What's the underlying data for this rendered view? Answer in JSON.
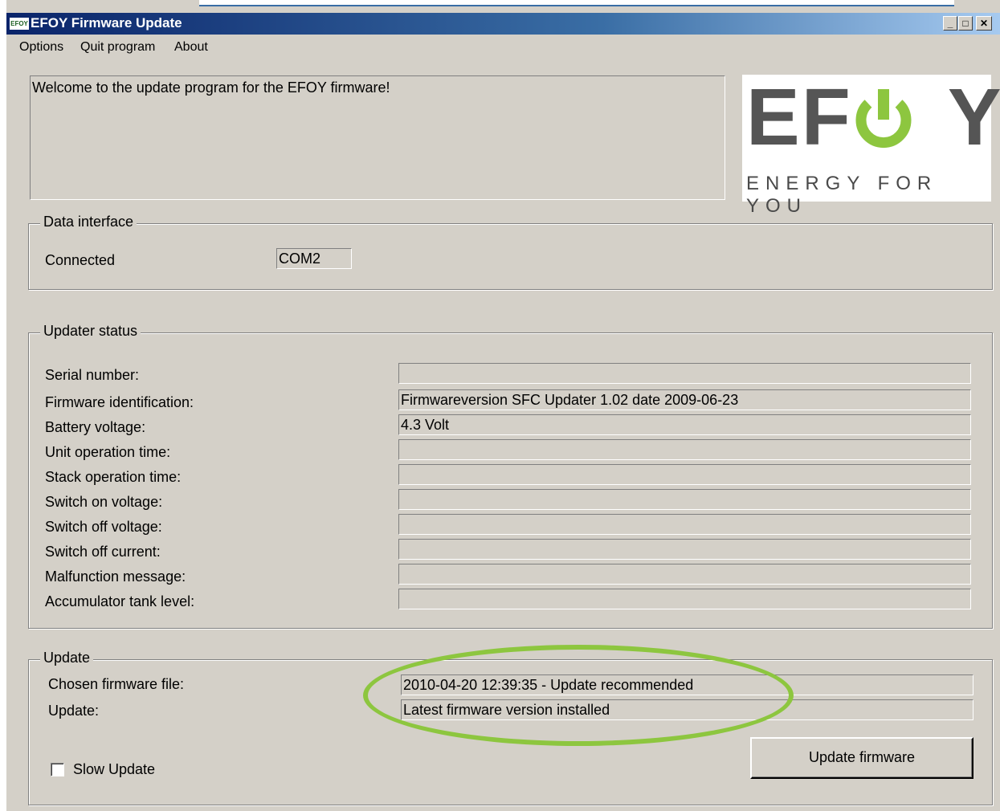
{
  "window": {
    "title": "EFOY Firmware Update",
    "icon_text": "EFOY"
  },
  "titlebar_buttons": {
    "minimize": "_",
    "maximize": "□",
    "close": "✕"
  },
  "menu": [
    "Options",
    "Quit program",
    "About"
  ],
  "welcome_message": "Welcome to the update program for the EFOY firmware!",
  "logo": {
    "word": "EFOY",
    "tagline": "ENERGY FOR YOU",
    "accent_color": "#8dc63f",
    "text_color": "#555555"
  },
  "data_interface": {
    "title": "Data interface",
    "label": "Connected",
    "value": "COM2"
  },
  "updater_status": {
    "title": "Updater status",
    "rows": [
      {
        "label": "Serial number:",
        "value": ""
      },
      {
        "label": "Firmware identification:",
        "value": "Firmwareversion SFC Updater 1.02 date 2009-06-23"
      },
      {
        "label": "Battery voltage:",
        "value": "4.3 Volt"
      },
      {
        "label": "Unit operation time:",
        "value": ""
      },
      {
        "label": "Stack operation time:",
        "value": ""
      },
      {
        "label": "Switch on voltage:",
        "value": ""
      },
      {
        "label": "Switch off voltage:",
        "value": ""
      },
      {
        "label": "Switch off current:",
        "value": ""
      },
      {
        "label": "Malfunction message:",
        "value": ""
      },
      {
        "label": "Accumulator tank level:",
        "value": ""
      }
    ]
  },
  "update": {
    "title": "Update",
    "chosen_file_label": "Chosen firmware file:",
    "chosen_file_value": "2010-04-20 12:39:35 - Update recommended",
    "update_label": "Update:",
    "update_value": "Latest firmware version installed",
    "button_label": "Update firmware",
    "slow_update_label": "Slow Update",
    "slow_update_checked": false
  },
  "annotation_color": "#8dc63f"
}
